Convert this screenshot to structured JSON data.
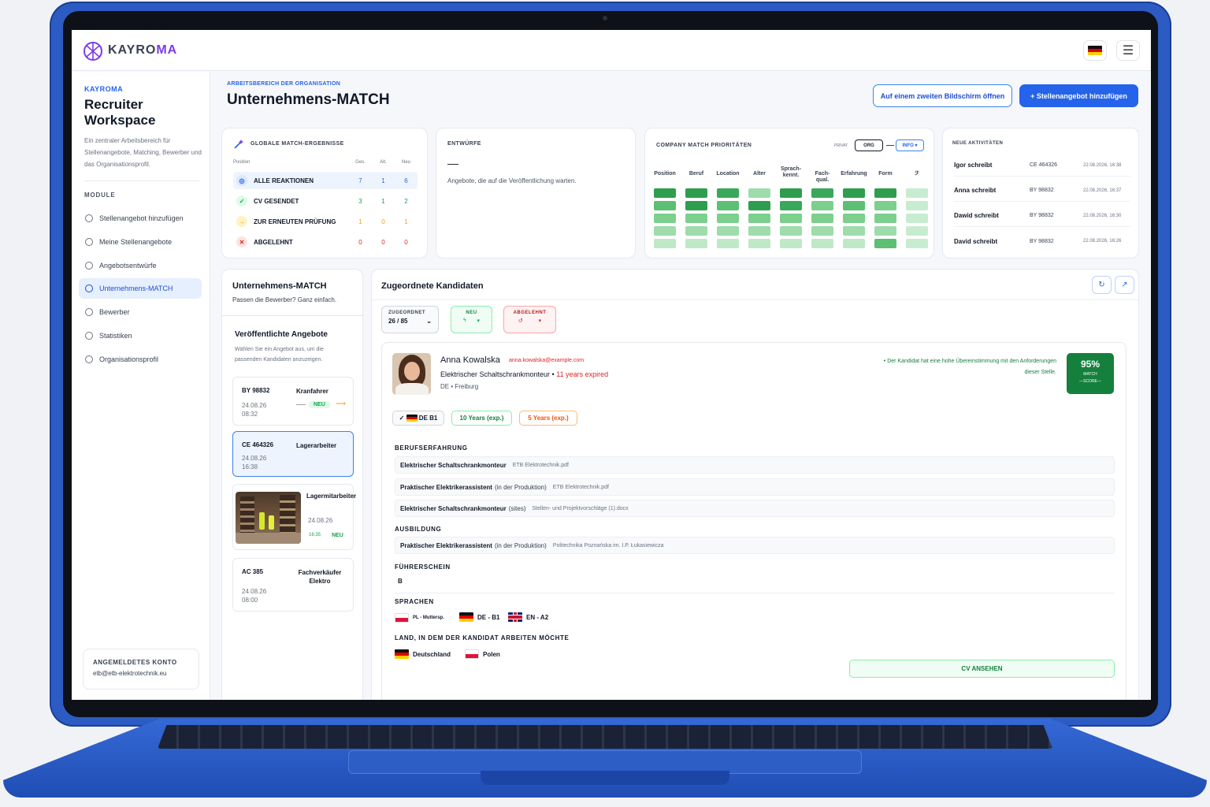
{
  "app": {
    "logo_a": "KAYRO",
    "logo_b": "MA"
  },
  "sidebar": {
    "kicker": "KAYROMA",
    "title": "Recruiter Workspace",
    "description": "Ein zentraler Arbeitsbereich für Stellenangebote, Matching, Bewerber und das Organisationsprofil.",
    "module_label": "MODULE",
    "items": [
      {
        "label": "Stellenangebot hinzufügen",
        "icon": "gear-icon"
      },
      {
        "label": "Meine Stellenangebote",
        "icon": "star-icon"
      },
      {
        "label": "Angebotsentwürfe",
        "icon": "user-icon"
      },
      {
        "label": "Unternehmens-MATCH",
        "icon": "target-icon",
        "active": true
      },
      {
        "label": "Bewerber",
        "icon": "users-icon"
      },
      {
        "label": "Statistiken",
        "icon": "chart-icon"
      },
      {
        "label": "Organisationsprofil",
        "icon": "building-icon"
      }
    ],
    "account_label": "ANGEMELDETES KONTO",
    "account_email": "etb@etb-elektrotechnik.eu"
  },
  "header": {
    "kicker": "ARBEITSBEREICH DER ORGANISATION",
    "title": "Unternehmens-MATCH",
    "btn_second_screen": "Auf einem zweiten Bildschirm öffnen",
    "btn_add_offer": "+ Stellenangebot hinzufügen"
  },
  "global_match": {
    "title": "GLOBALE MATCH-ERGEBNISSE",
    "col_position": "Position",
    "col_ges": "Ges.",
    "col_alt": "Alt.",
    "col_neu": "Neu",
    "rows": [
      {
        "label": "ALLE REAKTIONEN",
        "ges": "7",
        "alt": "1",
        "neu": "6",
        "color": "#2563eb"
      },
      {
        "label": "CV GESENDET",
        "ges": "3",
        "alt": "1",
        "neu": "2",
        "color": "#16a34a"
      },
      {
        "label": "ZUR ERNEUTEN PRÜFUNG",
        "ges": "1",
        "alt": "0",
        "neu": "1",
        "color": "#f59e0b"
      },
      {
        "label": "ABGELEHNT",
        "ges": "0",
        "alt": "0",
        "neu": "0",
        "color": "#dc2626"
      }
    ]
  },
  "drafts": {
    "title": "ENTWÜRFE",
    "dash": "—",
    "text": "Angebote, die auf die Veröffentlichung warten."
  },
  "priorities": {
    "title": "COMPANY MATCH PRIORITÄTEN",
    "privat": "PRIVAT",
    "org": "ORG",
    "info": "INFO ▾",
    "columns": [
      "Position",
      "Beruf",
      "Location",
      "Alter",
      "Sprach-kennt.",
      "Fach-qual.",
      "Erfahrung",
      "Form",
      "ℱ"
    ]
  },
  "activities": {
    "title": "NEUE AKTIVITÄTEN",
    "items": [
      {
        "who": "Igor schreibt",
        "code": "CE 464326",
        "ts": "22.08.2026, 16:38"
      },
      {
        "who": "Anna schreibt",
        "code": "BY 98832",
        "ts": "22.08.2026, 16:37"
      },
      {
        "who": "Dawid schreibt",
        "code": "BY 98832",
        "ts": "22.08.2026, 16:30"
      },
      {
        "who": "David schreibt",
        "code": "BY 98832",
        "ts": "22.08.2026, 16:26"
      }
    ]
  },
  "left_panel": {
    "title": "Unternehmens-MATCH",
    "subtitle": "Passen die Bewerber? Ganz einfach.",
    "offers_title": "Veröffentlichte Angebote",
    "offers_hint": "Wählen Sie ein Angebot aus, um die passenden Kandidaten anzuzeigen.",
    "offers": [
      {
        "code": "BY 98832",
        "role": "Kranfahrer",
        "date": "24.08.26 08:32",
        "badge": "NEU"
      },
      {
        "code": "CE 464326",
        "role": "Lagerarbeiter",
        "date": "24.08.26 16:38",
        "badge": ""
      },
      {
        "code": "",
        "role": "Lagermitarbeiter",
        "date": "24.08.26",
        "time": "16:35",
        "badge": "NEU"
      },
      {
        "code": "AC 385",
        "role": "Fachverkäufer Elektro",
        "date": "24.08.26 08:00",
        "badge": ""
      }
    ]
  },
  "candidates": {
    "title": "Zugeordnete Kandidaten",
    "filter_assigned_label": "ZUGEORDNET",
    "filter_assigned_value": "26 / 85",
    "filter_new_label": "NEU",
    "filter_rejected_label": "ABGELEHNT",
    "candidate": {
      "name": "Anna Kowalska",
      "email": "anna.kowalska@example.com",
      "job": "Elektrischer Schaltschrankmonteur •",
      "expired": "11 years expired",
      "location": "DE • Freiburg",
      "match_note": "• Der Kandidat hat eine hohe Übereinstimmung mit den Anforderungen dieser Stelle.",
      "match_score": "95%",
      "match_label": "MATCH",
      "score_label": "—SCORE—",
      "chip_lang": "DE B1",
      "chip_exp1": "10 Years (exp.)",
      "chip_exp2": "5 Years (exp.)",
      "sec_experience": "BERUFSERFAHRUNG",
      "experience": [
        {
          "title": "Elektrischer Schaltschrankmonteur",
          "sub": "",
          "src": "ETB Elektrotechnik.pdf"
        },
        {
          "title": "Praktischer Elektrikerassistent",
          "sub": "(in der Produktion)",
          "src": "ETB Elektrotechnik.pdf"
        },
        {
          "title": "Elektrischer Schaltschrankmonteur",
          "sub": "(sites)",
          "src": "Stellen- und Projektvorschläge (1).docx"
        }
      ],
      "sec_education": "AUSBILDUNG",
      "education": {
        "title": "Praktischer Elektrikerassistent",
        "sub": "(in der Produktion)",
        "src": "Politechnika Poznańska im. I.P. Łukasiewicza"
      },
      "sec_license": "FÜHRERSCHEIN",
      "license": "B",
      "sec_languages": "SPRACHEN",
      "languages": [
        {
          "label": "PL - Muttersp.",
          "flag": "pl"
        },
        {
          "label": "DE - B1",
          "flag": "de"
        },
        {
          "label": "EN - A2",
          "flag": "en"
        }
      ],
      "sec_countries": "LAND, IN DEM DER KANDIDAT ARBEITEN MÖCHTE",
      "countries": [
        {
          "label": "Deutschland",
          "flag": "de"
        },
        {
          "label": "Polen",
          "flag": "pl"
        }
      ],
      "cv_button": "CV ANSEHEN"
    }
  },
  "colors": {
    "accent": "#2563eb",
    "brand": "#7c3aed",
    "success": "#16a34a",
    "danger": "#dc2626",
    "warning": "#f59e0b",
    "match_bg": "#15803d"
  }
}
